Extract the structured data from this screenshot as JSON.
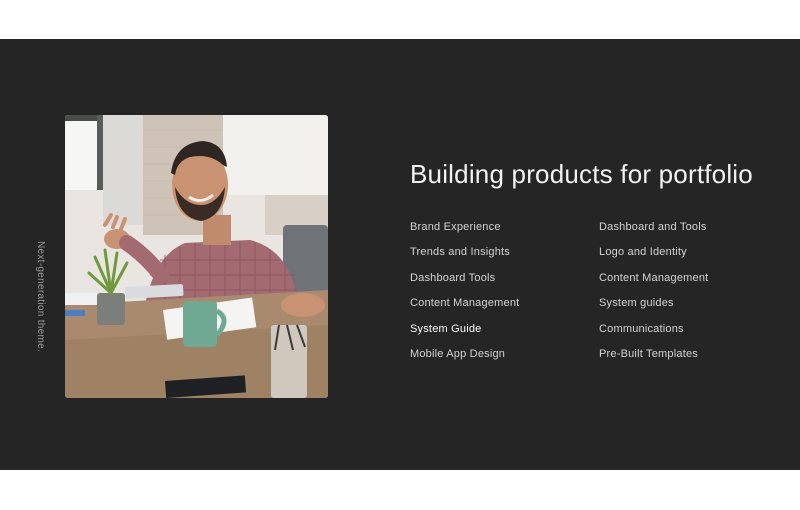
{
  "section": {
    "side_label": "Next-generation theme.",
    "photo_alt": "Smiling man at meeting table",
    "heading": "Building products for portfolio"
  },
  "links": {
    "column1": [
      {
        "label": "Brand Experience"
      },
      {
        "label": "Trends and Insights"
      },
      {
        "label": "Dashboard Tools"
      },
      {
        "label": "Content Management"
      },
      {
        "label": "System Guide"
      },
      {
        "label": "Mobile App Design"
      }
    ],
    "column2": [
      {
        "label": "Dashboard and Tools"
      },
      {
        "label": "Logo and Identity"
      },
      {
        "label": "Content Management"
      },
      {
        "label": "System guides"
      },
      {
        "label": "Communications"
      },
      {
        "label": "Pre-Built Templates"
      }
    ]
  },
  "colors": {
    "section_background": "#252525",
    "page_background": "#ffffff",
    "heading_text": "#f2f2f2",
    "link_text": "#d4d4d4",
    "side_label_text": "#9a9a9a"
  }
}
